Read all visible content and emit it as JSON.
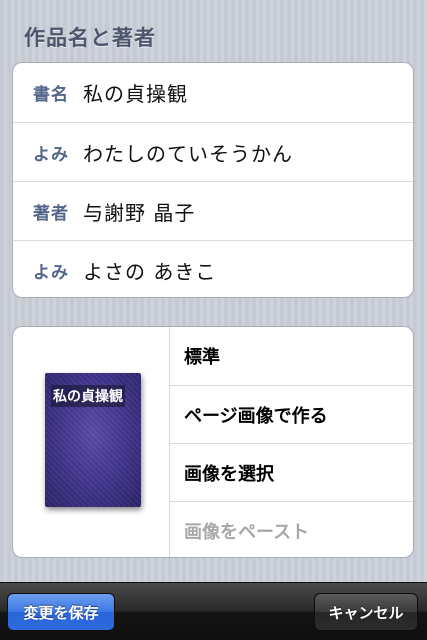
{
  "section_header": "作品名と著者",
  "fields": [
    {
      "label": "書名",
      "value": "私の貞操観"
    },
    {
      "label": "よみ",
      "value": "わたしのていそうかん"
    },
    {
      "label": "著者",
      "value": "与謝野 晶子"
    },
    {
      "label": "よみ",
      "value": "よさの あきこ"
    }
  ],
  "cover": {
    "book_title": "私の貞操観",
    "options": [
      {
        "label": "標準",
        "enabled": true
      },
      {
        "label": "ページ画像で作る",
        "enabled": true
      },
      {
        "label": "画像を選択",
        "enabled": true
      },
      {
        "label": "画像をペースト",
        "enabled": false
      }
    ]
  },
  "toolbar": {
    "save_label": "変更を保存",
    "cancel_label": "キャンセル"
  },
  "colors": {
    "label": "#52668a",
    "save_button": "#3b78e5",
    "disabled_text": "#a8a8a8"
  }
}
